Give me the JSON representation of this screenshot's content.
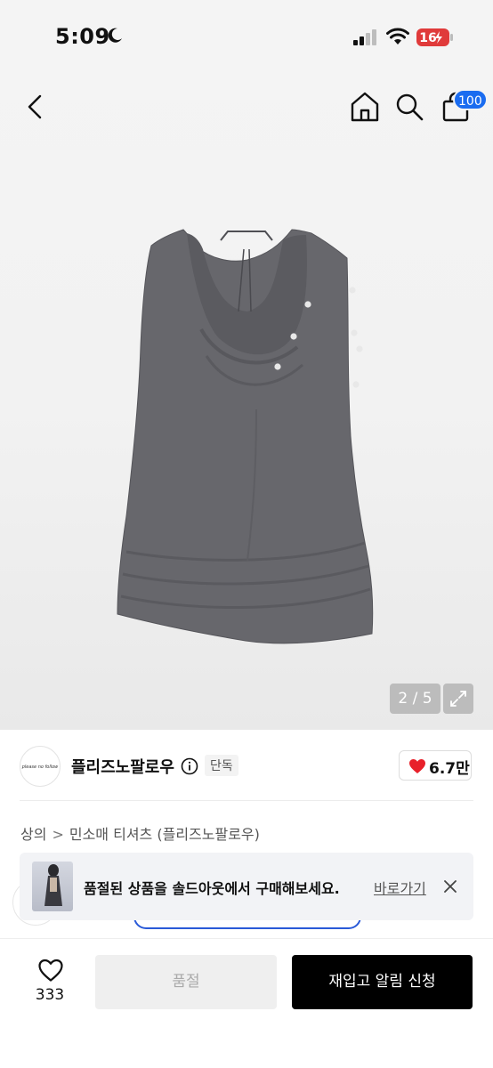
{
  "status_bar": {
    "time": "5:09",
    "battery": "16"
  },
  "header": {
    "cart_badge": "100"
  },
  "gallery": {
    "counter": "2 / 5"
  },
  "brand": {
    "logo_text": "please no follow",
    "name": "플리즈노팔로우",
    "tag": "단독",
    "likes": "6.7만"
  },
  "breadcrumb": {
    "category": "상의",
    "separator": ">",
    "subcategory": "민소매 티셔츠 (플리즈노팔로우)"
  },
  "banner": {
    "message": "품절된 상품을 솔드아웃에서 구매해보세요.",
    "link": "바로가기"
  },
  "bottom_bar": {
    "wish_count": "333",
    "soldout_label": "품절",
    "restock_label": "재입고 알림 신청"
  },
  "colors": {
    "accent_blue": "#1a6cf0",
    "heart_red": "#e8202a",
    "garment_gray": "#6b6b70"
  },
  "icons": [
    "back-icon",
    "home-icon",
    "search-icon",
    "bag-icon",
    "expand-icon",
    "info-icon",
    "heart-icon",
    "close-icon"
  ]
}
